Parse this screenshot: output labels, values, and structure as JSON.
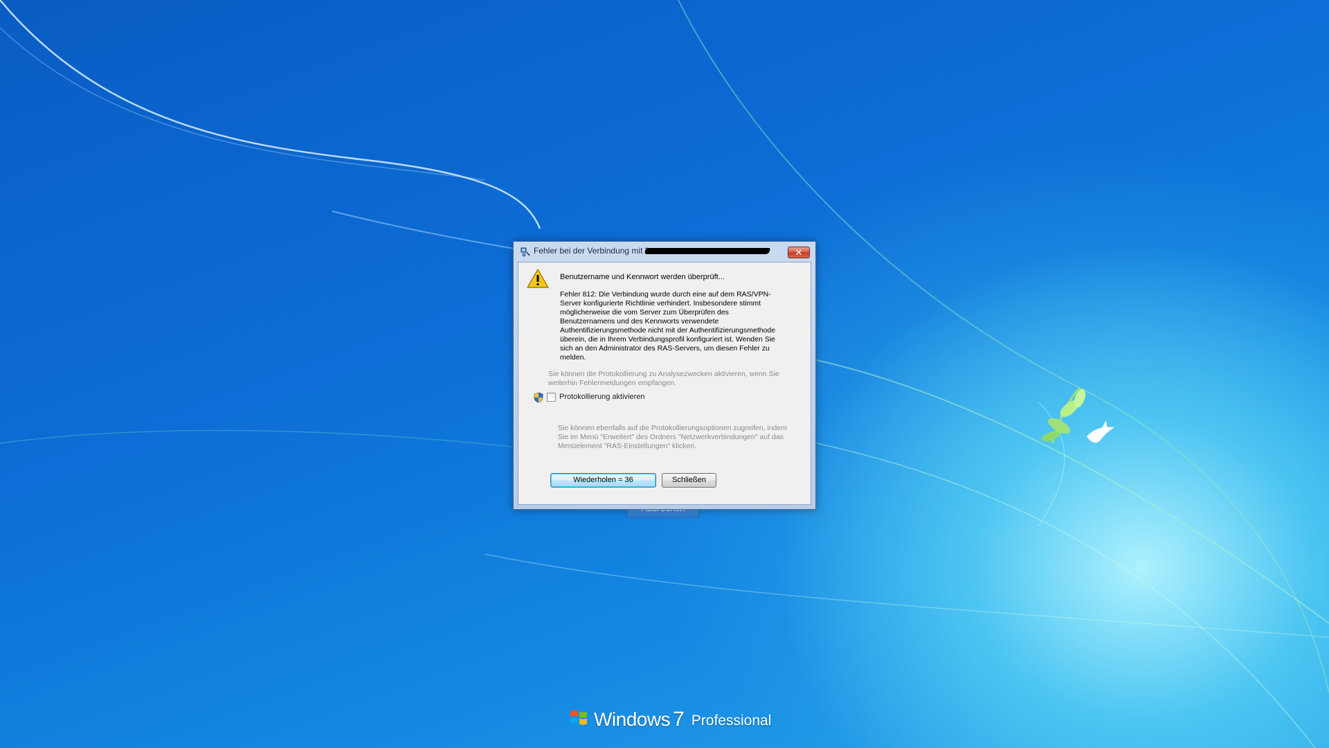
{
  "desktop": {
    "background_colors": {
      "top": "#0a5cc4",
      "bottom_right_glow": "#b4f5ff"
    },
    "logo": {
      "word": "Windows",
      "version": "7",
      "edition": "Professional"
    },
    "background_dialog": {
      "button_label": "Abbrechen"
    }
  },
  "dialog": {
    "title": "Fehler bei der Verbindung mit \"",
    "title_icon": "network-connection-icon",
    "close_icon": "close-icon",
    "warning_icon": "warning-icon",
    "status_line": "Benutzername und Kennwort werden überprüft...",
    "error_text": "Fehler 812: Die Verbindung wurde durch eine auf dem RAS/VPN-Server konfigurierte Richtlinie verhindert. Insbesondere stimmt möglicherweise die vom Server zum Überprüfen des Benutzernamens und des Kennworts verwendete Authentifizierungsmethode nicht mit der Authentifizierungsmethode überein, die in Ihrem Verbindungsprofil konfiguriert ist. Wenden Sie sich an den Administrator des RAS-Servers, um diesen Fehler zu melden.",
    "log_hint": "Sie können die Protokollierung zu Analysezwecken aktivieren, wenn Sie weiterhin Fehlermeldungen empfangen.",
    "log_checkbox": {
      "label": "Protokollierung aktivieren",
      "checked": false,
      "shield_icon": "uac-shield-icon"
    },
    "options_hint": "Sie können ebenfalls auf die Protokollierungsoptionen zugreifen, indem Sie im Menü \"Erweitert\" des Ordners \"Netzwerkverbindungen\" auf das Menüelement \"RAS-Einstellungen\" klicken.",
    "buttons": {
      "retry": "Wiederholen = 36",
      "close": "Schließen"
    }
  }
}
